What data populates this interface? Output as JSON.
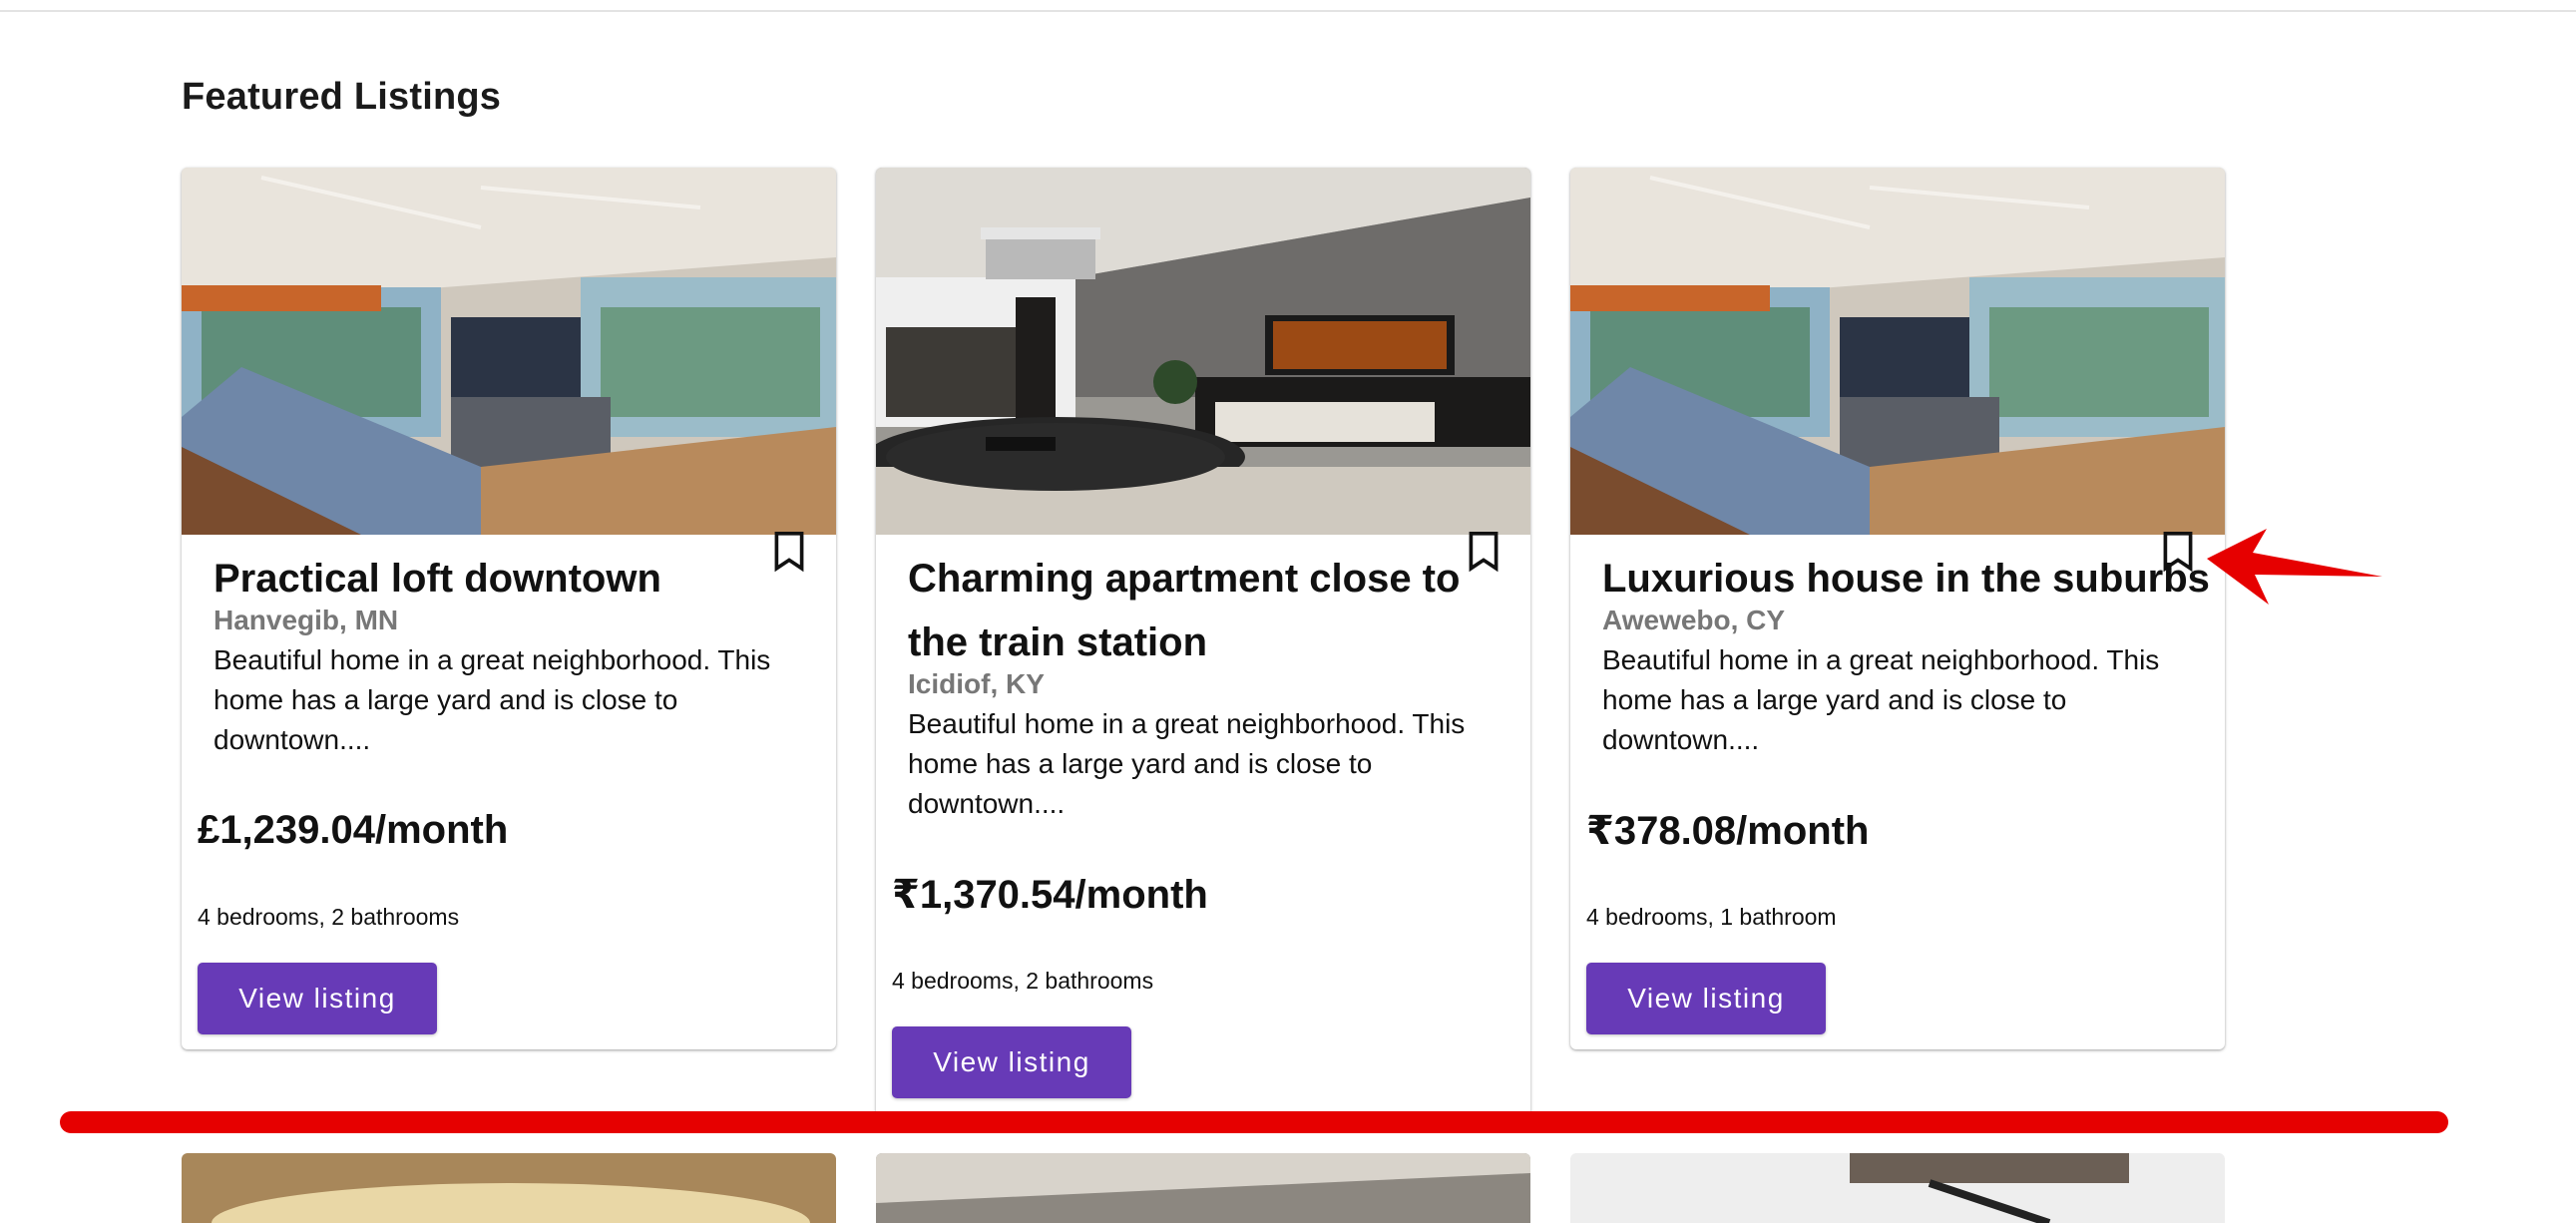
{
  "page": {
    "section_title": "Featured Listings"
  },
  "listings": [
    {
      "title": "Practical loft downtown",
      "location": "Hanvegib, MN",
      "description": "Beautiful home in a great neighborhood. This home has a large yard and is close to downtown....",
      "price": "£1,239.04/month",
      "rooms": "4 bedrooms, 2 bathrooms",
      "button_label": "View listing",
      "image": "modern-open-kitchen-living-room",
      "bookmark_icon": "bookmark-outline-icon"
    },
    {
      "title": "Charming apartment close to the train station",
      "location": "Icidiof, KY",
      "description": "Beautiful home in a great neighborhood. This home has a large yard and is close to downtown....",
      "price": "₹1,370.54/month",
      "rooms": "4 bedrooms, 2 bathrooms",
      "button_label": "View listing",
      "image": "living-room-with-chandelier",
      "bookmark_icon": "bookmark-outline-icon"
    },
    {
      "title": "Luxurious house in the suburbs",
      "location": "Awewebo, CY",
      "description": "Beautiful home in a great neighborhood. This home has a large yard and is close to downtown....",
      "price": "₹378.08/month",
      "rooms": "4 bedrooms, 1 bathroom",
      "button_label": "View listing",
      "image": "modern-open-kitchen-living-room",
      "bookmark_icon": "bookmark-outline-icon"
    }
  ],
  "colors": {
    "button": "#673ab7",
    "location_text": "#777777",
    "annotation": "#e60000"
  }
}
